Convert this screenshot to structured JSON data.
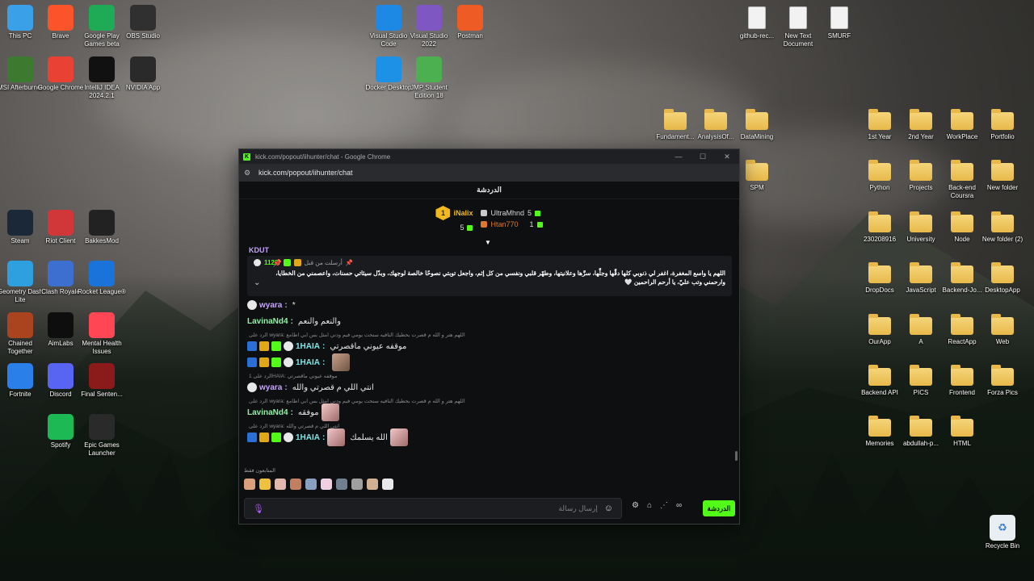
{
  "desktop": {
    "icons_left": [
      {
        "label": "This PC",
        "icon": "monitor-icon",
        "color": "#3aa0e8"
      },
      {
        "label": "Brave",
        "icon": "brave-icon",
        "color": "#fb542b"
      },
      {
        "label": "Google Play Games beta",
        "icon": "google-play-games-icon",
        "color": "#1faa55"
      },
      {
        "label": "OBS Studio",
        "icon": "obs-icon",
        "color": "#303030"
      },
      {
        "label": "MSI Afterburner",
        "icon": "msi-afterburner-icon",
        "color": "#3c7a30"
      },
      {
        "label": "Google Chrome",
        "icon": "chrome-icon",
        "color": "#e94235"
      },
      {
        "label": "IntelliJ IDEA 2024.2.1",
        "icon": "intellij-icon",
        "color": "#111111"
      },
      {
        "label": "NVIDIA App",
        "icon": "nvidia-icon",
        "color": "#2a2a2a"
      },
      {
        "label": "Steam",
        "icon": "steam-icon",
        "color": "#1b2838"
      },
      {
        "label": "Riot Client",
        "icon": "riot-client-icon",
        "color": "#d13639"
      },
      {
        "label": "BakkesMod",
        "icon": "bakkesmod-icon",
        "color": "#222222"
      },
      {
        "label": "Geometry Dash Lite",
        "icon": "geometry-dash-icon",
        "color": "#2ea0e0"
      },
      {
        "label": "Clash Royale",
        "icon": "clash-royale-icon",
        "color": "#3d6fd0"
      },
      {
        "label": "Rocket League®",
        "icon": "rocket-league-icon",
        "color": "#1a73d8"
      },
      {
        "label": "Chained Together",
        "icon": "chained-together-icon",
        "color": "#a9441e"
      },
      {
        "label": "AimLabs",
        "icon": "aimlabs-icon",
        "color": "#0e0e0e"
      },
      {
        "label": "Mental Health Issues",
        "icon": "valorant-icon",
        "color": "#ff4655"
      },
      {
        "label": "Fortnite",
        "icon": "fortnite-icon",
        "color": "#2a7fe8"
      },
      {
        "label": "Discord",
        "icon": "discord-icon",
        "color": "#5865f2"
      },
      {
        "label": "Final Senten...",
        "icon": "final-sentence-icon",
        "color": "#8b1a1a"
      },
      {
        "label": "Spotify",
        "icon": "spotify-icon",
        "color": "#1db954"
      },
      {
        "label": "Epic Games Launcher",
        "icon": "epic-games-icon",
        "color": "#2a2a2a"
      }
    ],
    "icons_center": [
      {
        "label": "Visual Studio Code",
        "icon": "vscode-icon",
        "color": "#1e88e5"
      },
      {
        "label": "Visual Studio 2022",
        "icon": "visual-studio-icon",
        "color": "#7e57c2"
      },
      {
        "label": "Postman",
        "icon": "postman-icon",
        "color": "#ef5b25"
      },
      {
        "label": "Docker Desktop",
        "icon": "docker-icon",
        "color": "#1d91e6"
      },
      {
        "label": "JMP Student Edition 18",
        "icon": "jmp-icon",
        "color": "#4caf50"
      }
    ],
    "icons_files": [
      {
        "label": "github-rec..."
      },
      {
        "label": "New Text Document"
      },
      {
        "label": "SMURF"
      }
    ],
    "folders_mid": [
      {
        "label": "Fundament..."
      },
      {
        "label": "AnalysisOf..."
      },
      {
        "label": "DataMining"
      },
      {
        "label": "SPM"
      }
    ],
    "folders_right": [
      {
        "label": "1st Year"
      },
      {
        "label": "2nd Year"
      },
      {
        "label": "WorkPlace"
      },
      {
        "label": "Portfolio"
      },
      {
        "label": "Python"
      },
      {
        "label": "Projects"
      },
      {
        "label": "Back-end Coursra"
      },
      {
        "label": "New folder"
      },
      {
        "label": "230208916"
      },
      {
        "label": "University"
      },
      {
        "label": "Node"
      },
      {
        "label": "New folder (2)"
      },
      {
        "label": "DropDocs"
      },
      {
        "label": "JavaScript"
      },
      {
        "label": "Backend-Jo..."
      },
      {
        "label": "DesktopApp"
      },
      {
        "label": "OurApp"
      },
      {
        "label": "A"
      },
      {
        "label": "ReactApp"
      },
      {
        "label": "Web"
      },
      {
        "label": "Backend API"
      },
      {
        "label": "PICS"
      },
      {
        "label": "Frontend"
      },
      {
        "label": "Forza Pics"
      },
      {
        "label": "Memories"
      },
      {
        "label": "abdullah-p..."
      },
      {
        "label": "HTML"
      }
    ],
    "recycle_bin": "Recycle Bin"
  },
  "window": {
    "title": "kick.com/popout/iihunter/chat - Google Chrome",
    "url": "kick.com/popout/iihunter/chat",
    "controls": {
      "minimize": "—",
      "maximize": "☐",
      "close": "✕"
    }
  },
  "chat": {
    "header": "الدردشة",
    "leaderboard": {
      "first": {
        "rank": "1",
        "name": "iNalix",
        "count": "5"
      },
      "second": {
        "name": "UltraMhnd",
        "count": "5"
      },
      "third": {
        "name": "Htan770",
        "count": "1"
      }
    },
    "cutoff_name": "KDUT",
    "pinned": {
      "username": "1122i",
      "meta": "أرسلت من قبل",
      "text": "اللهم يا واسع المغفرة، اغفر لي ذنوبي كلها دقَّها وجلَّها، سرَّها وعلانيتها، وطهّر قلبي ونفسي من كل إثم، واجعل توبتي نصوحًا خالصة لوجهك، وبدّل سيئاتي حسنات، واعصمني من الخطايا، وارحمني وتب عليّ، يا أرحم الراحمين 🤍"
    },
    "messages": [
      {
        "reply": "",
        "user": "wyara",
        "text": "*",
        "color": "purple"
      },
      {
        "reply": "",
        "user": "LavinaNd4",
        "text": "والنعم والنعم",
        "color": "green"
      },
      {
        "reply": "الرد على wyara: اللهم هتر و الله م قصرت بحطيك النافيه سنحت يومي فيم ودني امثل بس ابي اطامع",
        "user": "1HAIA",
        "text": "موقفه عيوني ماقصرتي",
        "color": "cyan"
      },
      {
        "reply": "",
        "user": "1HAIA",
        "text": "",
        "color": "cyan"
      },
      {
        "reply": "الرد على 1HAIA: موقفه عيوني ماقصرتي",
        "user": "wyara",
        "text": "انتي اللي م قصرتي والله",
        "color": "purple"
      },
      {
        "reply": "الرد على wyara: اللهم هتر و الله م قصرت بحطيك النافيه سنحت يومي فيم ودني امثل بس ابي اطامع",
        "user": "LavinaNd4",
        "text": "موفقه",
        "color": "green"
      },
      {
        "reply": "الرد على wyara: انتي اللي م قصرتي والله",
        "user": "1HAIA",
        "text": "الله يسلمك",
        "color": "cyan"
      }
    ],
    "subs_only": "المتابعون فقط",
    "composer_placeholder": "إرسال رسالة",
    "send_label": "الدردشة"
  }
}
